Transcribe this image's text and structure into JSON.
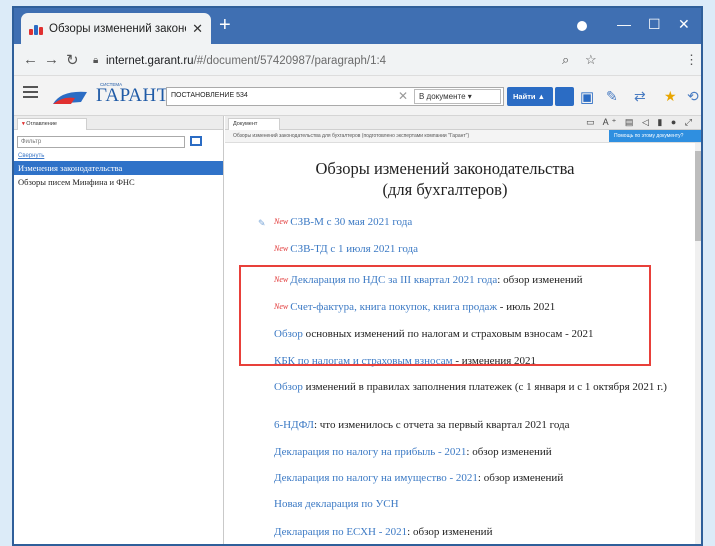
{
  "browser": {
    "tab_title": "Обзоры изменений законодател",
    "url_domain": "internet.garant.ru",
    "url_path": "/#/document/57420987/paragraph/1:4"
  },
  "garant": {
    "logo_text": "ГАРАНТ",
    "logo_sub": "СИСТЕМА",
    "search_value": "ПОСТАНОВЛЕНИЕ 534",
    "scope": "В документе",
    "find_button": "Найти"
  },
  "left_panel": {
    "tab_label": "Оглавление",
    "filter_placeholder": "Фильтр",
    "collapse": "Свернуть",
    "items": [
      "Изменения законодательства",
      "Обзоры писем Минфина и ФНС"
    ]
  },
  "document": {
    "tab_label": "Документ",
    "breadcrumb": "Обзоры изменений законодательства для бухгалтеров (подготовлено экспертами компании \"Гарант\")",
    "ask_button": "Помощь по этому документу?",
    "title_line1": "Обзоры изменений законодательства",
    "title_line2": "(для бухгалтеров)",
    "new_mark": "New",
    "entries": [
      {
        "new": true,
        "link": "СЗВ-М с 30 мая 2021 года",
        "text": ""
      },
      {
        "new": true,
        "link": "СЗВ-ТД с 1 июля 2021 года",
        "text": ""
      },
      {
        "new": true,
        "link": "Декларация по НДС за III квартал 2021 года",
        "text": ": обзор изменений"
      },
      {
        "new": true,
        "link": "Счет-фактура, книга покупок, книга продаж",
        "text": " - июль 2021"
      },
      {
        "new": false,
        "link": "Обзор",
        "text": " основных изменений по налогам и страховым взносам - 2021"
      },
      {
        "new": false,
        "link": "КБК по налогам и страховым взносам",
        "text": " - изменения 2021"
      },
      {
        "new": false,
        "link": "Обзор",
        "text": " изменений в правилах заполнения платежек (с 1 января и с 1 октября 2021 г.)"
      },
      {
        "new": false,
        "link": "6-НДФЛ",
        "text": ": что изменилось с отчета за первый квартал 2021 года"
      },
      {
        "new": false,
        "link": "Декларация по налогу на прибыль - 2021",
        "text": ": обзор изменений"
      },
      {
        "new": false,
        "link": "Декларация по налогу на имущество - 2021",
        "text": ": обзор изменений"
      },
      {
        "new": false,
        "link": "Новая декларация по УСН",
        "text": ""
      },
      {
        "new": false,
        "link": "Декларация по ЕСХН - 2021",
        "text": ": обзор изменений"
      }
    ]
  },
  "colors": {
    "accent": "#2b6cc4",
    "link": "#3b79c4",
    "highlight": "#e8403a",
    "new": "#e03030"
  }
}
